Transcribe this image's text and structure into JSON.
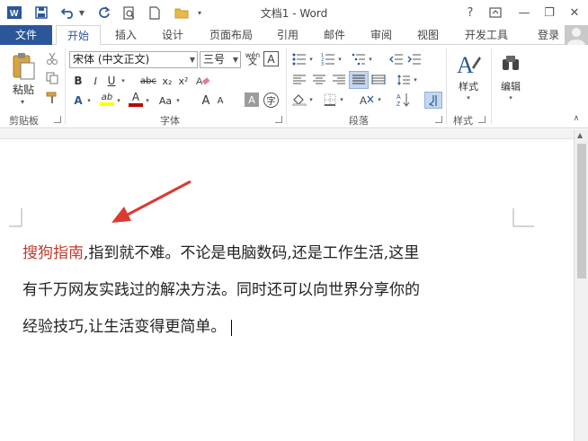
{
  "window": {
    "title": "文档1 - Word",
    "help_label": "?",
    "minimize_label": "—",
    "restore_label": "❐",
    "close_label": "✕"
  },
  "tabs": {
    "file": "文件",
    "home": "开始",
    "insert": "插入",
    "design": "设计",
    "layout": "页面布局",
    "references": "引用",
    "mailings": "邮件",
    "review": "审阅",
    "view": "视图",
    "developer": "开发工具",
    "signin": "登录"
  },
  "ribbon": {
    "clipboard": {
      "label": "剪贴板",
      "paste": "粘贴"
    },
    "font": {
      "label": "字体",
      "font_name": "宋体 (中文正文)",
      "font_size": "三号",
      "phonetic": "wén",
      "bold": "B",
      "italic": "I",
      "underline": "U",
      "strikethrough": "abc",
      "subscript": "x₂",
      "superscript": "x²",
      "text_effect": "A",
      "highlight": "ab",
      "font_color": "A",
      "change_case": "Aa",
      "grow": "A",
      "shrink": "A",
      "char_shading": "A",
      "enclose": "字"
    },
    "paragraph": {
      "label": "段落"
    },
    "styles": {
      "label": "样式",
      "button": "样式"
    },
    "editing": {
      "button": "编辑"
    }
  },
  "document": {
    "red_text": "搜狗指南",
    "line1_rest": ",指到就不难。不论是电脑数码,还是工作生活,这里",
    "line2": "有千万网友实践过的解决方法。同时还可以向世界分享你的",
    "line3": "经验技巧,让生活变得更简单。"
  },
  "colors": {
    "accent": "#2b579a",
    "red_text": "#c0392b",
    "arrow": "#d93a32",
    "highlight": "#ffff00",
    "font_color_bar": "#c00000"
  }
}
